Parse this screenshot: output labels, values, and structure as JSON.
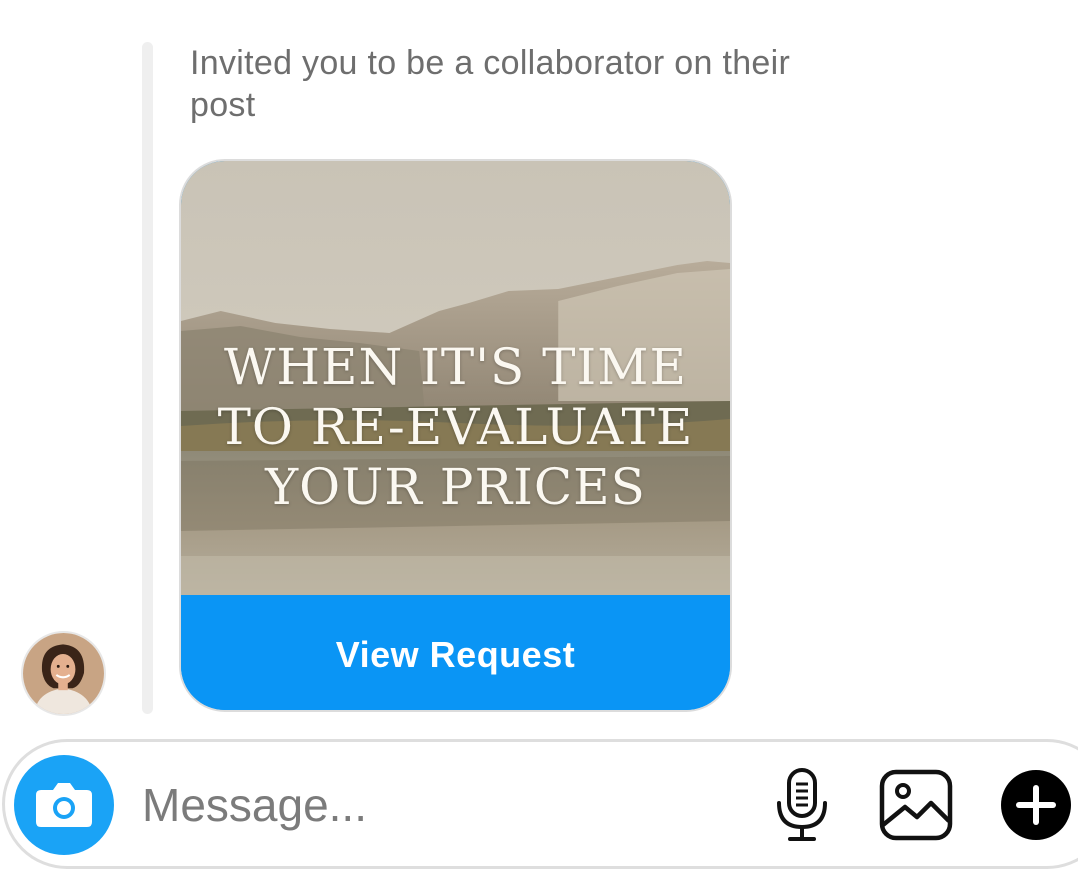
{
  "thread": {
    "invite_text": "Invited you to be a collaborator on their post"
  },
  "post_card": {
    "headline": [
      "WHEN IT'S TIME",
      "TO RE-EVALUATE",
      "YOUR PRICES"
    ],
    "action_label": "View Request",
    "action_color": "#0A95F5"
  },
  "sender": {
    "avatar_icon": "profile-photo"
  },
  "composer": {
    "placeholder": "Message...",
    "camera_icon": "camera-icon",
    "mic_icon": "microphone-icon",
    "gallery_icon": "image-gallery-icon",
    "plus_icon": "plus-circle-icon",
    "camera_color": "#1AA3F6"
  }
}
